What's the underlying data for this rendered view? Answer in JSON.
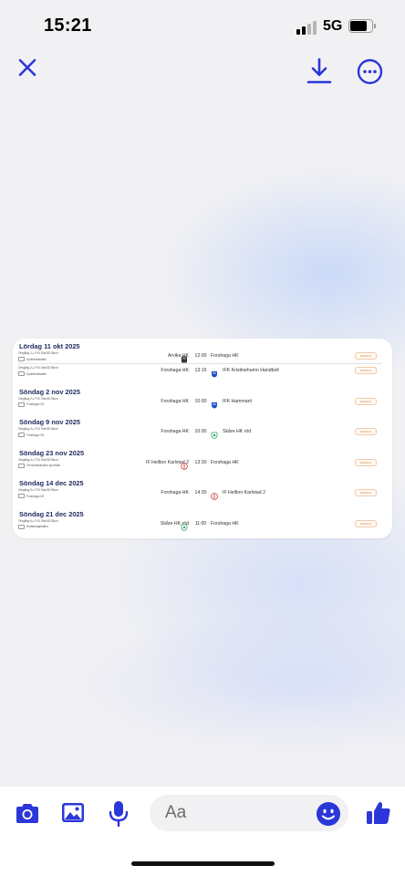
{
  "status_bar": {
    "time": "15:21",
    "network": "5G"
  },
  "colors": {
    "accent": "#2b37d8",
    "primary_text": "#1f2a5e"
  },
  "toolbar": {
    "close_icon": "close-icon",
    "download_icon": "download-icon",
    "more_icon": "more-options-icon"
  },
  "document": {
    "days": [
      {
        "title": "Lördag 11 okt 2025",
        "matches": [
          {
            "meta_line": "Omgång 1 ▸ P10 Stat 5D Bkun",
            "venue": "Kyrkebanhallen",
            "home": "Arvika HK",
            "time": "12:00",
            "away": "Forshaga HK",
            "home_logo": "arvika-logo",
            "away_logo": "",
            "badge": "Matchinfo"
          },
          {
            "meta_line": "Omgång 2 ▸ P10 Stat 5D Bkun",
            "venue": "Kyrkebanhallen",
            "home": "Forshaga HK",
            "time": "13:15",
            "away": "IFK Kristinehamn Handboll",
            "home_logo": "",
            "away_logo": "ifk-logo",
            "badge": "Matchinfo"
          }
        ]
      },
      {
        "title": "Söndag 2 nov 2025",
        "matches": [
          {
            "meta_line": "Omgång 2 ▸ P10 Stat 5D Bkun",
            "venue": "Forshaga GH",
            "home": "Forshaga HK",
            "time": "10:00",
            "away": "IFK Hammarö",
            "home_logo": "",
            "away_logo": "ifk-logo",
            "badge": "Matchinfo"
          }
        ]
      },
      {
        "title": "Söndag 9 nov 2025",
        "matches": [
          {
            "meta_line": "Omgång 3 ▸ P10 Stat 5D Bkun",
            "venue": "Forshaga GH",
            "home": "Forshaga HK",
            "time": "10:00",
            "away": "Skåre HK röd",
            "home_logo": "",
            "away_logo": "skare-logo",
            "badge": "Matchinfo"
          }
        ]
      },
      {
        "title": "Söndag 23 nov 2025",
        "matches": [
          {
            "meta_line": "Omgång 4 ▸ P10 Stat 5D Bkun",
            "venue": "Orrholmsskolans sporthall",
            "home": "IF Hellton Karlstad 2",
            "time": "13:30",
            "away": "Forshaga HK",
            "home_logo": "hellton-logo",
            "away_logo": "",
            "badge": "Matchinfo"
          }
        ]
      },
      {
        "title": "Söndag 14 dec 2025",
        "matches": [
          {
            "meta_line": "Omgång 5 ▸ P10 Stat 5D Bkun",
            "venue": "Forshaga GH",
            "home": "Forshaga HK",
            "time": "14:30",
            "away": "IF Hellton Karlstad 2",
            "home_logo": "",
            "away_logo": "hellton-logo",
            "badge": "Matchinfo"
          }
        ]
      },
      {
        "title": "Söndag 21 dec 2025",
        "matches": [
          {
            "meta_line": "Omgång 6 ▸ P10 Stat 5D Bkun",
            "venue": "Hultsbergshallen",
            "home": "Skåre HK röd",
            "time": "11:00",
            "away": "Forshaga HK",
            "home_logo": "skare-logo",
            "away_logo": "",
            "badge": "Matchinfo"
          }
        ]
      }
    ]
  },
  "bottom_bar": {
    "message_placeholder": "Aa",
    "icons": [
      "camera-icon",
      "photo-icon",
      "microphone-icon",
      "emoji-icon",
      "thumbs-up-icon"
    ]
  }
}
